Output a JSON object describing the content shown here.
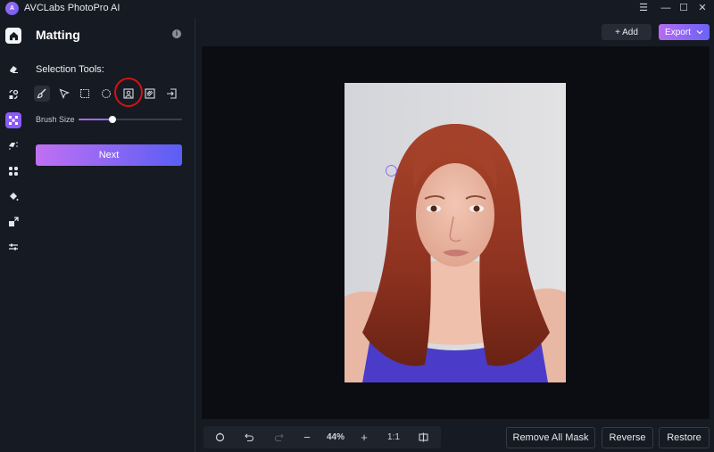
{
  "app": {
    "title": "AVCLabs PhotoPro AI",
    "logo_text": "A"
  },
  "window_controls": {
    "menu": "☰",
    "minimize": "—",
    "maximize": "☐",
    "close": "✕"
  },
  "rail": {
    "items": [
      {
        "name": "home",
        "icon": "home-icon"
      },
      {
        "name": "eraser",
        "icon": "eraser-icon"
      },
      {
        "name": "object-swap",
        "icon": "shapes-icon"
      },
      {
        "name": "matting",
        "icon": "matting-icon",
        "active": true
      },
      {
        "name": "enhance",
        "icon": "sparkle-icon"
      },
      {
        "name": "face",
        "icon": "face-icon"
      },
      {
        "name": "colorize",
        "icon": "paint-bucket-icon"
      },
      {
        "name": "upscale",
        "icon": "expand-icon"
      },
      {
        "name": "adjust",
        "icon": "sliders-icon"
      }
    ]
  },
  "panel": {
    "title": "Matting",
    "info_icon": "i",
    "selection_tools_label": "Selection Tools:",
    "tools": [
      {
        "name": "brush",
        "active": true
      },
      {
        "name": "pointer"
      },
      {
        "name": "rectangle"
      },
      {
        "name": "ellipse"
      },
      {
        "name": "portrait",
        "highlighted": true
      },
      {
        "name": "pattern"
      },
      {
        "name": "import"
      }
    ],
    "brush_size_label": "Brush Size",
    "brush_size_fraction": 0.33,
    "next_label": "Next"
  },
  "header": {
    "add_label": "+ Add",
    "export_label": "Export",
    "export_caret": "⌄"
  },
  "bottom_toolbar": {
    "zoom_level": "44%",
    "one_to_one": "1:1",
    "minus": "−",
    "plus": "+"
  },
  "actions": {
    "remove_all_mask": "Remove All Mask",
    "reverse": "Reverse",
    "restore": "Restore"
  },
  "colors": {
    "accent_start": "#c170f2",
    "accent_end": "#5a5ef5",
    "highlight_ring": "#d01414"
  }
}
